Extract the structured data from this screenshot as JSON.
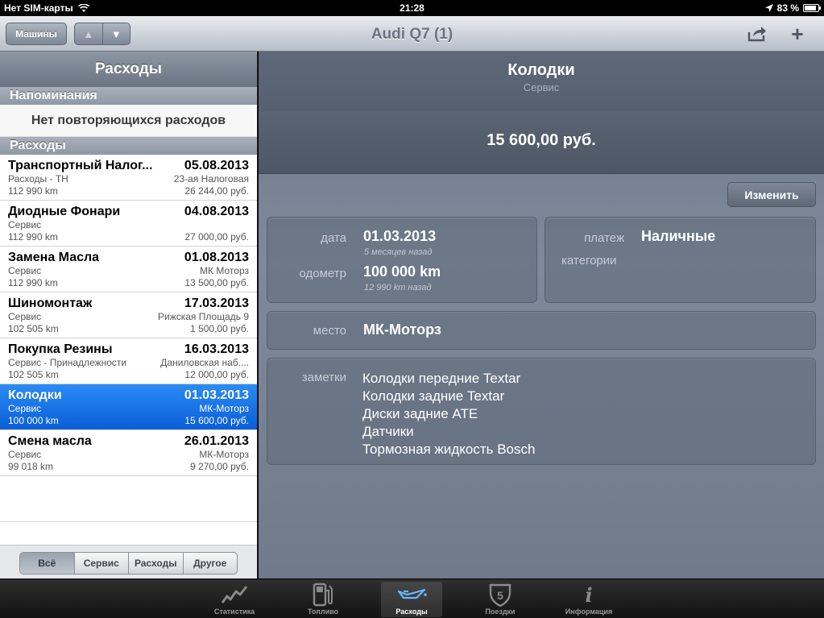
{
  "status": {
    "carrier": "Нет SIM-карты",
    "time": "21:28",
    "battery": "83 %"
  },
  "nav": {
    "cars_button": "Машины",
    "title": "Audi Q7 (1)"
  },
  "left": {
    "header": "Расходы",
    "reminders_header": "Напоминания",
    "reminders_empty": "Нет повторяющихся расходов",
    "expenses_header": "Расходы",
    "items": [
      {
        "name": "Транспортный Налог...",
        "date": "05.08.2013",
        "category": "Расходы - ТН",
        "place": "23-ая Налоговая",
        "odometer": "112 990 km",
        "amount": "26 244,00 руб."
      },
      {
        "name": "Диодные Фонари",
        "date": "04.08.2013",
        "category": "Сервис",
        "place": "",
        "odometer": "112 990 km",
        "amount": "27 000,00 руб."
      },
      {
        "name": "Замена Масла",
        "date": "01.08.2013",
        "category": "Сервис",
        "place": "МК Моторз",
        "odometer": "112 990 km",
        "amount": "13 500,00 руб."
      },
      {
        "name": "Шиномонтаж",
        "date": "17.03.2013",
        "category": "Сервис",
        "place": "Рижская Площадь 9",
        "odometer": "102 505 km",
        "amount": "1 500,00 руб."
      },
      {
        "name": "Покупка Резины",
        "date": "16.03.2013",
        "category": "Сервис - Принадлежности",
        "place": "Даниловская наб....",
        "odometer": "102 505 km",
        "amount": "12 000,00 руб."
      },
      {
        "name": "Колодки",
        "date": "01.03.2013",
        "category": "Сервис",
        "place": "МК-Моторз",
        "odometer": "100 000 km",
        "amount": "15 600,00 руб."
      },
      {
        "name": "Смена масла",
        "date": "26.01.2013",
        "category": "Сервис",
        "place": "МК-Моторз",
        "odometer": "99 018 km",
        "amount": "9 270,00 руб."
      }
    ],
    "filters": [
      "Всё",
      "Сервис",
      "Расходы",
      "Другое"
    ]
  },
  "detail": {
    "title": "Колодки",
    "subtitle": "Сервис",
    "price": "15 600,00 руб.",
    "edit_button": "Изменить",
    "date_label": "дата",
    "date_value": "01.03.2013",
    "date_sub": "5 месяцев назад",
    "odometer_label": "одометр",
    "odometer_value": "100 000 km",
    "odometer_sub": "12 990 km назад",
    "payment_label": "платеж",
    "payment_value": "Наличные",
    "categories_label": "категории",
    "place_label": "место",
    "place_value": "МК-Моторз",
    "notes_label": "заметки",
    "notes": [
      "Колодки передние Textar",
      "Колодки задние Textar",
      "Диски задние ATE",
      "Датчики",
      "Тормозная жидкость Bosch"
    ]
  },
  "tabs": [
    {
      "label": "Статистика",
      "icon": "chart-icon"
    },
    {
      "label": "Топливо",
      "icon": "fuel-pump-icon"
    },
    {
      "label": "Расходы",
      "icon": "oil-can-icon"
    },
    {
      "label": "Поездки",
      "icon": "route-shield-icon",
      "badge": "5"
    },
    {
      "label": "Информация",
      "icon": "info-icon",
      "glyph": "i"
    }
  ]
}
